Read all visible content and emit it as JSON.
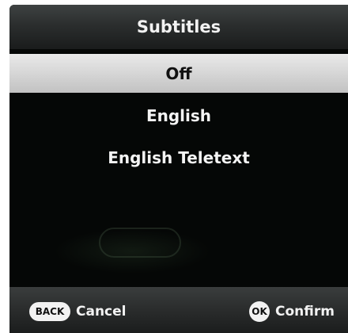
{
  "dialog": {
    "title": "Subtitles"
  },
  "options": [
    {
      "label": "Off",
      "selected": true
    },
    {
      "label": "English",
      "selected": false
    },
    {
      "label": "English Teletext",
      "selected": false
    }
  ],
  "footer": {
    "back_key": "BACK",
    "back_label": "Cancel",
    "ok_key": "OK",
    "ok_label": "Confirm"
  },
  "colors": {
    "highlight": "#d6d6d6",
    "background": "#000000",
    "text": "#f4f4f4"
  }
}
